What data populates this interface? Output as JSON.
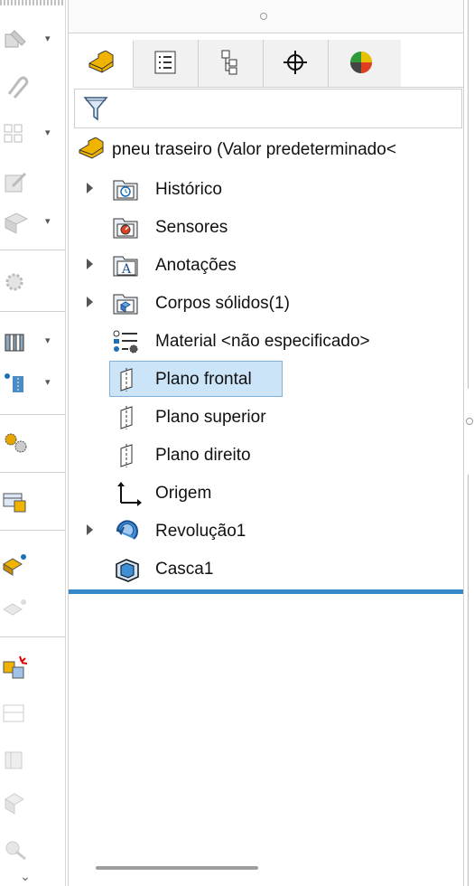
{
  "toolbar": {
    "icons": [
      "sketch-icon",
      "paperclip-icon",
      "grid-icon",
      "edit-icon",
      "feature-icon",
      "gear-icon",
      "column-icon",
      "plane-icon",
      "gears-icon",
      "table-icon",
      "part-icon",
      "part-faded-icon",
      "explode-icon",
      "layout-icon",
      "assembly-icon",
      "assembly-2-icon",
      "wrench-icon"
    ],
    "dropdown_glyph": "▾",
    "more_glyph": "⌄"
  },
  "tabs": [
    {
      "name": "tab-featuremanager",
      "icon": "part-tab-icon"
    },
    {
      "name": "tab-propertymanager",
      "icon": "property-list-icon"
    },
    {
      "name": "tab-configurationmanager",
      "icon": "configuration-icon"
    },
    {
      "name": "tab-dimxpert",
      "icon": "crosshair-icon"
    },
    {
      "name": "tab-display",
      "icon": "color-wheel-icon"
    }
  ],
  "scroll": {
    "left": "◂",
    "right": "▸"
  },
  "tree": {
    "root": {
      "label": "pneu traseiro  (Valor predeterminado<"
    },
    "items": [
      {
        "label": "Histórico",
        "expandable": true,
        "icon": "history-folder-icon"
      },
      {
        "label": "Sensores",
        "expandable": false,
        "icon": "sensor-folder-icon"
      },
      {
        "label": "Anotações",
        "expandable": true,
        "icon": "annotation-folder-icon"
      },
      {
        "label": "Corpos sólidos(1)",
        "expandable": true,
        "icon": "solid-bodies-folder-icon"
      },
      {
        "label": "Material <não especificado>",
        "expandable": false,
        "icon": "material-icon"
      },
      {
        "label": "Plano frontal",
        "expandable": false,
        "icon": "plane-icon",
        "selected": true
      },
      {
        "label": "Plano superior",
        "expandable": false,
        "icon": "plane-icon"
      },
      {
        "label": "Plano direito",
        "expandable": false,
        "icon": "plane-icon"
      },
      {
        "label": "Origem",
        "expandable": false,
        "icon": "origin-icon"
      },
      {
        "label": "Revolução1",
        "expandable": true,
        "icon": "revolve-icon"
      },
      {
        "label": "Casca1",
        "expandable": false,
        "icon": "shell-icon"
      }
    ]
  },
  "colors": {
    "accent": "#3288c8",
    "selection": "#cce4f7",
    "part_yellow": "#f0b400"
  }
}
